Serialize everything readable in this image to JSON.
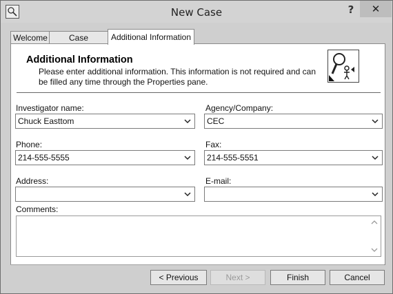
{
  "window": {
    "title": "New Case",
    "help_label": "?",
    "close_label": "✕",
    "app_icon": "case-app-icon"
  },
  "tabs": [
    {
      "label": "Welcome",
      "active": false
    },
    {
      "label": "Case Properties",
      "active": false
    },
    {
      "label": "Additional Information",
      "active": true
    }
  ],
  "header": {
    "heading": "Additional Information",
    "description": "Please enter additional information. This information is not required and can be filled any time through the Properties pane.",
    "icon": "investigator-icon"
  },
  "form": {
    "investigator": {
      "label": "Investigator name:",
      "value": "Chuck Easttom"
    },
    "agency": {
      "label": "Agency/Company:",
      "value": "CEC"
    },
    "phone": {
      "label": "Phone:",
      "value": "214-555-5555"
    },
    "fax": {
      "label": "Fax:",
      "value": "214-555-5551"
    },
    "address": {
      "label": "Address:",
      "value": ""
    },
    "email": {
      "label": "E-mail:",
      "value": ""
    },
    "comments": {
      "label": "Comments:",
      "value": ""
    }
  },
  "buttons": {
    "previous": "< Previous",
    "next": "Next >",
    "finish": "Finish",
    "cancel": "Cancel"
  }
}
